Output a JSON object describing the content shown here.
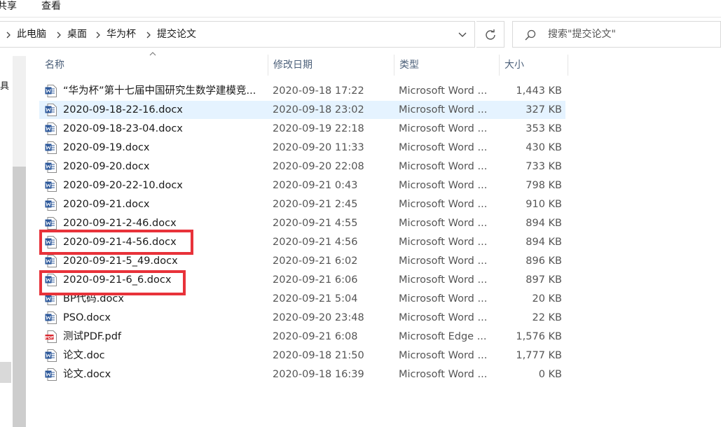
{
  "ribbon": {
    "tabs": [
      "共享",
      "查看"
    ]
  },
  "address_bar": {
    "breadcrumb": [
      "此电脑",
      "桌面",
      "华为杯",
      "提交论文"
    ]
  },
  "search": {
    "placeholder": "搜索\"提交论文\""
  },
  "nav": {
    "partial_label": "具"
  },
  "columns": {
    "name": "名称",
    "date": "修改日期",
    "type": "类型",
    "size": "大小"
  },
  "files": [
    {
      "name": "“华为杯”第十七届中国研究生数学建模竞...",
      "date": "2020-09-18 17:22",
      "type": "Microsoft Word ...",
      "size": "1,443 KB",
      "icon": "word-doc-icon"
    },
    {
      "name": "2020-09-18-22-16.docx",
      "date": "2020-09-18 23:02",
      "type": "Microsoft Word ...",
      "size": "327 KB",
      "icon": "word-doc-icon"
    },
    {
      "name": "2020-09-18-23-04.docx",
      "date": "2020-09-19 22:18",
      "type": "Microsoft Word ...",
      "size": "353 KB",
      "icon": "word-doc-icon"
    },
    {
      "name": "2020-09-19.docx",
      "date": "2020-09-20 11:33",
      "type": "Microsoft Word ...",
      "size": "430 KB",
      "icon": "word-doc-icon"
    },
    {
      "name": "2020-09-20.docx",
      "date": "2020-09-20 22:08",
      "type": "Microsoft Word ...",
      "size": "733 KB",
      "icon": "word-doc-icon"
    },
    {
      "name": "2020-09-20-22-10.docx",
      "date": "2020-09-21 0:43",
      "type": "Microsoft Word ...",
      "size": "798 KB",
      "icon": "word-doc-icon"
    },
    {
      "name": "2020-09-21.docx",
      "date": "2020-09-21 2:45",
      "type": "Microsoft Word ...",
      "size": "910 KB",
      "icon": "word-doc-icon"
    },
    {
      "name": "2020-09-21-2-46.docx",
      "date": "2020-09-21 4:55",
      "type": "Microsoft Word ...",
      "size": "894 KB",
      "icon": "word-doc-icon"
    },
    {
      "name": "2020-09-21-4-56.docx",
      "date": "2020-09-21 4:56",
      "type": "Microsoft Word ...",
      "size": "894 KB",
      "icon": "word-doc-icon"
    },
    {
      "name": "2020-09-21-5_49.docx",
      "date": "2020-09-21 6:02",
      "type": "Microsoft Word ...",
      "size": "896 KB",
      "icon": "word-doc-icon"
    },
    {
      "name": "2020-09-21-6_6.docx",
      "date": "2020-09-21 6:06",
      "type": "Microsoft Word ...",
      "size": "897 KB",
      "icon": "word-doc-icon"
    },
    {
      "name": "BP代码.docx",
      "date": "2020-09-21 5:04",
      "type": "Microsoft Word ...",
      "size": "20 KB",
      "icon": "word-doc-icon"
    },
    {
      "name": "PSO.docx",
      "date": "2020-09-20 23:48",
      "type": "Microsoft Word ...",
      "size": "22 KB",
      "icon": "word-doc-icon"
    },
    {
      "name": "测试PDF.pdf",
      "date": "2020-09-21 6:08",
      "type": "Microsoft Edge ...",
      "size": "1,576 KB",
      "icon": "pdf-icon"
    },
    {
      "name": "论文.doc",
      "date": "2020-09-18 21:50",
      "type": "Microsoft Word ...",
      "size": "1,777 KB",
      "icon": "word-doc-icon"
    },
    {
      "name": "论文.docx",
      "date": "2020-09-18 16:39",
      "type": "Microsoft Word ...",
      "size": "0 KB",
      "icon": "word-doc-icon"
    }
  ],
  "hovered_row": 1,
  "highlighted_rows": [
    8,
    10
  ],
  "colors": {
    "hover_background": "#e5f3ff",
    "highlight_border": "#e8323a",
    "word_blue": "#2b579a",
    "pdf_red": "#d8232a",
    "header_text": "#4c607a"
  }
}
